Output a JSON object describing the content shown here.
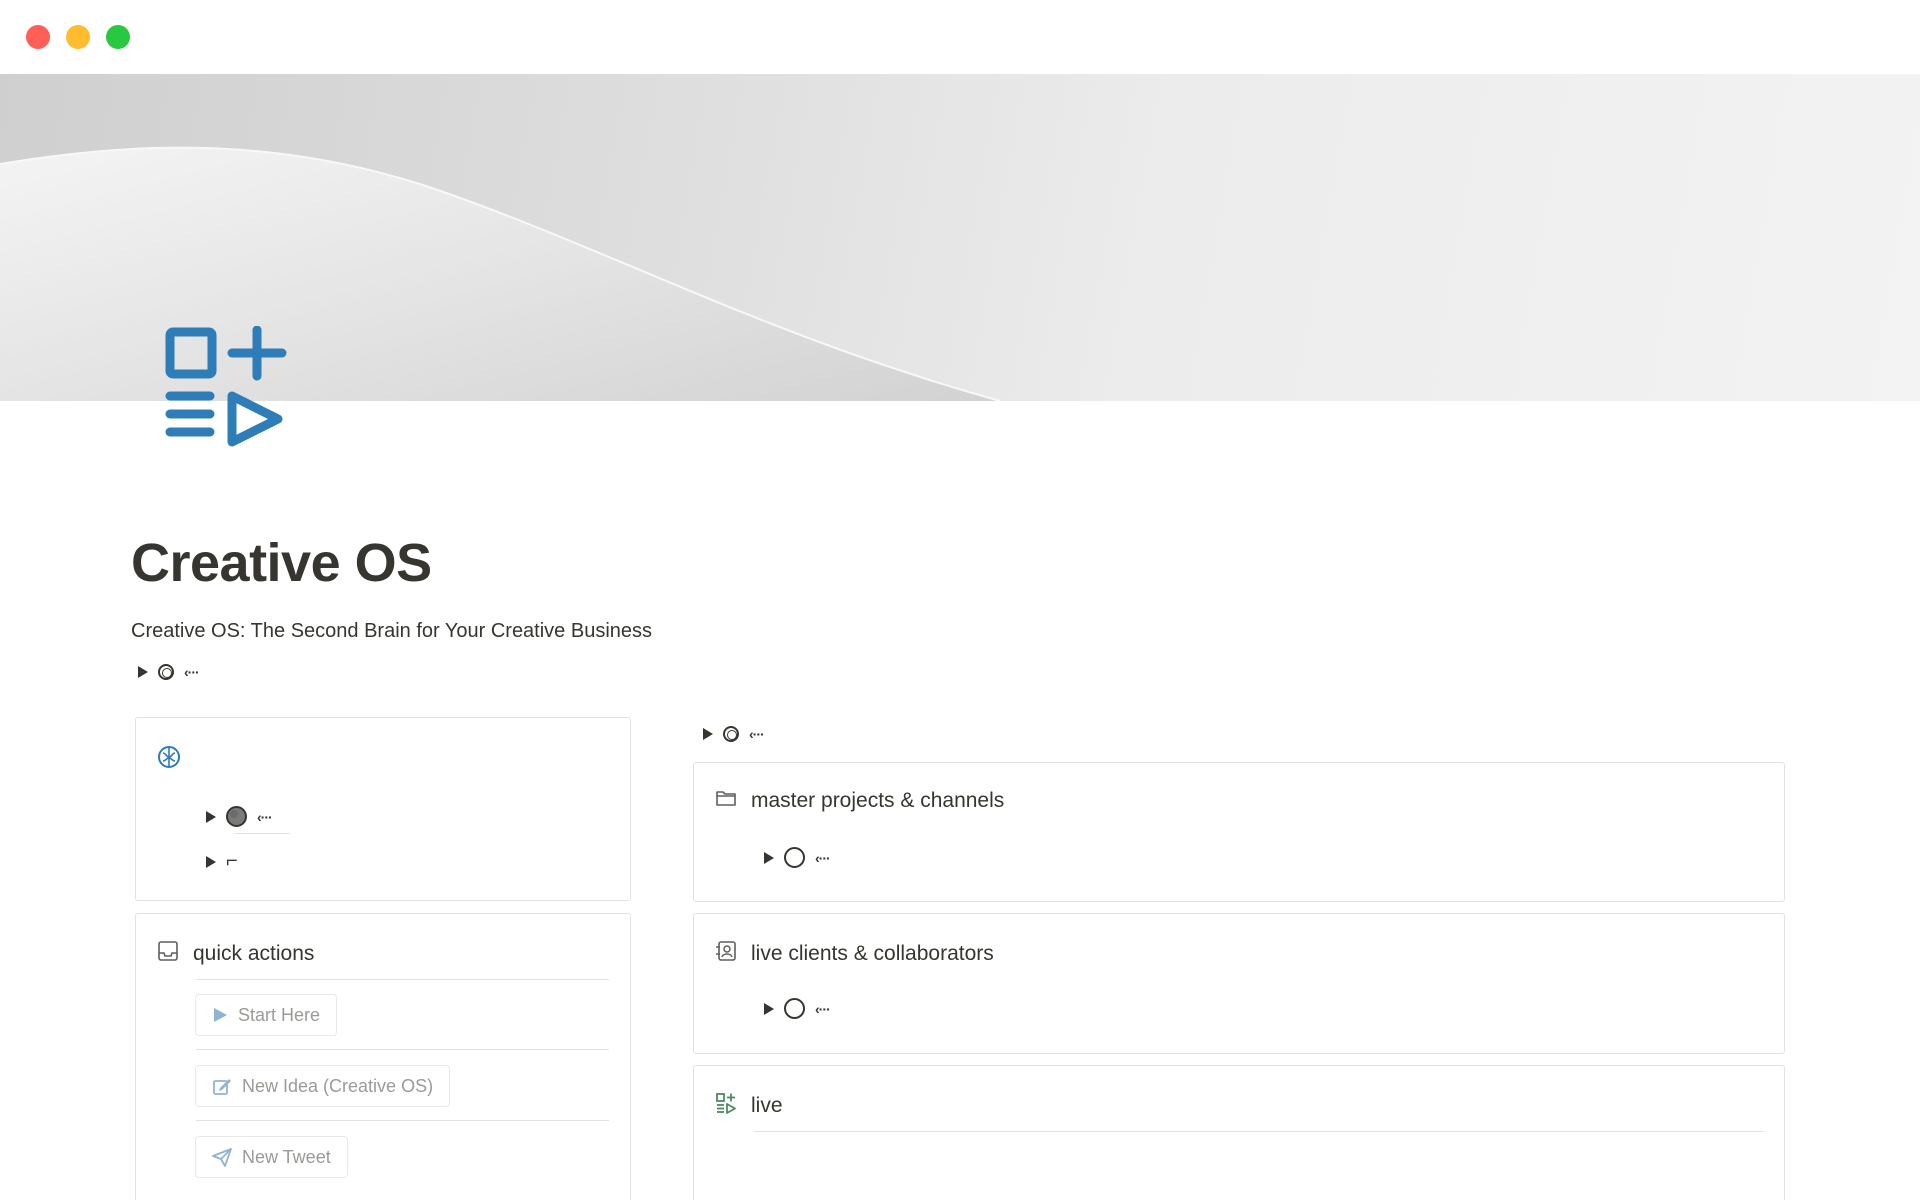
{
  "window": {
    "controls": [
      "close",
      "minimize",
      "zoom"
    ]
  },
  "page": {
    "icon": "form-plus-list-play-icon",
    "icon_color": "#2e7cb8",
    "title": "Creative OS",
    "subtitle": "Creative OS: The Second Brain for Your Creative Business",
    "toggle_glyph": "‹···"
  },
  "left_column": {
    "brain_card": {
      "icon": "brain-icon",
      "icon_color": "#2e7cb8",
      "toggle1_glyph": "‹···",
      "toggle2_glyph": "⌐"
    },
    "quick_actions": {
      "icon": "inbox-icon",
      "title": "quick actions",
      "buttons": [
        {
          "label": "Start Here",
          "icon": "play-icon"
        },
        {
          "label": "New Idea (Creative OS)",
          "icon": "edit-icon"
        },
        {
          "label": "New Tweet",
          "icon": "send-icon"
        }
      ]
    }
  },
  "right_column": {
    "toggle_glyph": "‹···",
    "cards": [
      {
        "icon": "folder-icon",
        "title": "master projects & channels",
        "toggle_glyph": "‹···"
      },
      {
        "icon": "contacts-icon",
        "title": "live clients & collaborators",
        "toggle_glyph": "‹···"
      },
      {
        "icon": "live-icon",
        "title": "live",
        "icon_color": "#4a8c5f"
      }
    ]
  }
}
